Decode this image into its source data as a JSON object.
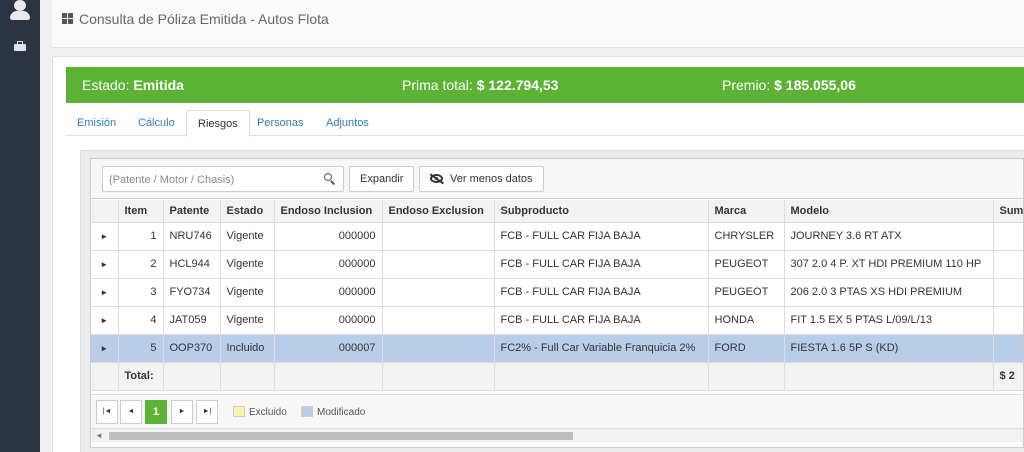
{
  "page": {
    "title": "Consulta de Póliza Emitida - Autos Flota"
  },
  "sidebar": {
    "icons": [
      "user-icon",
      "briefcase-icon"
    ]
  },
  "status": {
    "estado_label": "Estado:",
    "estado_value": "Emitida",
    "prima_label": "Prima total:",
    "prima_value": "$ 122.794,53",
    "premio_label": "Premio:",
    "premio_value": "$ 185.055,06",
    "bar_color": "#5cb234"
  },
  "tabs": [
    {
      "label": "Emisión",
      "active": false
    },
    {
      "label": "Cálculo",
      "active": false
    },
    {
      "label": "Riesgos",
      "active": true
    },
    {
      "label": "Personas",
      "active": false
    },
    {
      "label": "Adjuntos",
      "active": false
    }
  ],
  "toolbar": {
    "search_placeholder": "(Patente / Motor / Chasis)",
    "search_value": "",
    "expand_label": "Expandir",
    "less_data_label": "Ver menos datos"
  },
  "table": {
    "columns": [
      "",
      "Item",
      "Patente",
      "Estado",
      "Endoso Inclusion",
      "Endoso Exclusion",
      "Subproducto",
      "Marca",
      "Modelo",
      "Sum"
    ],
    "rows": [
      {
        "item": "1",
        "patente": "NRU746",
        "estado": "Vigente",
        "endoso_inclusion": "000000",
        "endoso_exclusion": "",
        "subproducto": "FCB - FULL CAR FIJA BAJA",
        "marca": "CHRYSLER",
        "modelo": "JOURNEY 3.6 RT ATX",
        "sum": "$",
        "selected": false
      },
      {
        "item": "2",
        "patente": "HCL944",
        "estado": "Vigente",
        "endoso_inclusion": "000000",
        "endoso_exclusion": "",
        "subproducto": "FCB - FULL CAR FIJA BAJA",
        "marca": "PEUGEOT",
        "modelo": "307 2.0 4 P. XT HDI PREMIUM 110 HP",
        "sum": "$",
        "selected": false
      },
      {
        "item": "3",
        "patente": "FYO734",
        "estado": "Vigente",
        "endoso_inclusion": "000000",
        "endoso_exclusion": "",
        "subproducto": "FCB - FULL CAR FIJA BAJA",
        "marca": "PEUGEOT",
        "modelo": "206 2.0 3 PTAS XS HDI PREMIUM",
        "sum": "$",
        "selected": false
      },
      {
        "item": "4",
        "patente": "JAT059",
        "estado": "Vigente",
        "endoso_inclusion": "000000",
        "endoso_exclusion": "",
        "subproducto": "FCB - FULL CAR FIJA BAJA",
        "marca": "HONDA",
        "modelo": "FIT 1.5 EX 5 PTAS L/09/L/13",
        "sum": "$",
        "selected": false
      },
      {
        "item": "5",
        "patente": "OOP370",
        "estado": "Incluido",
        "endoso_inclusion": "000007",
        "endoso_exclusion": "",
        "subproducto": "FC2% - Full Car Variable Franquicia 2%",
        "marca": "FORD",
        "modelo": "FIESTA 1.6 5P S (KD)",
        "sum": "$",
        "selected": true
      }
    ],
    "total_label": "Total:",
    "total_value": "$ 2",
    "selected_row_color": "#b7cde8"
  },
  "pager": {
    "current_page": "1",
    "legend_excluded": "Excluido",
    "legend_modified": "Modificado",
    "excluded_color": "#fbf3b0",
    "modified_color": "#b7cde8"
  }
}
